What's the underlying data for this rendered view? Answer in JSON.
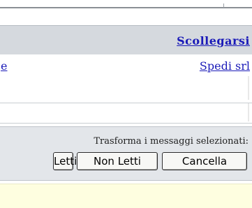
{
  "header": {
    "logout_label": "Scollegarsi"
  },
  "message_row": {
    "left_link_label": "e",
    "right_link_label": "Spedi srl"
  },
  "actions": {
    "caption": "Trasforma i messaggi selezionati:",
    "read_label": "Letti",
    "unread_label": "Non Letti",
    "delete_label": "Cancella"
  },
  "colors": {
    "link": "#1a1ab8",
    "header_bg": "#d5d9de",
    "actions_bg": "#e3e6ea",
    "notice_bg": "#fefee0"
  }
}
